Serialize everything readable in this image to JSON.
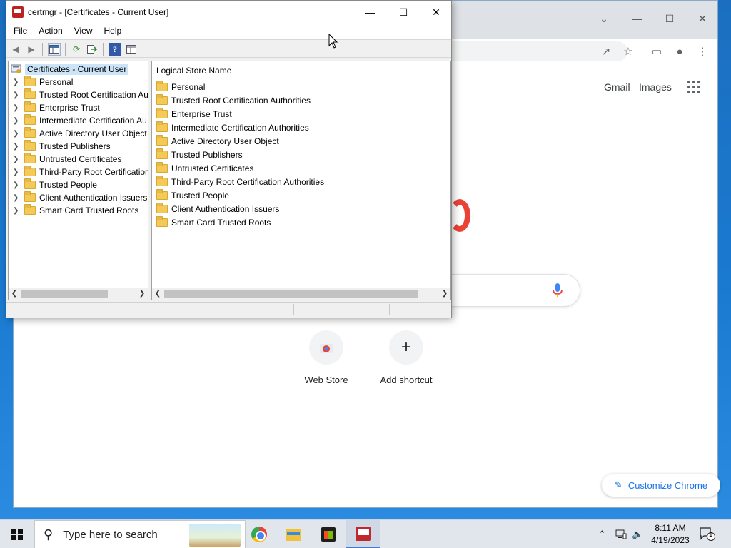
{
  "certmgr": {
    "title": "certmgr - [Certificates - Current User]",
    "menu": [
      "File",
      "Action",
      "View",
      "Help"
    ],
    "tree_root": "Certificates - Current User",
    "tree_items": [
      "Personal",
      "Trusted Root Certification Au",
      "Enterprise Trust",
      "Intermediate Certification Au",
      "Active Directory User Object",
      "Trusted Publishers",
      "Untrusted Certificates",
      "Third-Party Root Certificatior",
      "Trusted People",
      "Client Authentication Issuers",
      "Smart Card Trusted Roots"
    ],
    "list_header": "Logical Store Name",
    "list_items": [
      "Personal",
      "Trusted Root Certification Authorities",
      "Enterprise Trust",
      "Intermediate Certification Authorities",
      "Active Directory User Object",
      "Trusted Publishers",
      "Untrusted Certificates",
      "Third-Party Root Certification Authorities",
      "Trusted People",
      "Client Authentication Issuers",
      "Smart Card Trusted Roots"
    ]
  },
  "chrome": {
    "gmail": "Gmail",
    "images": "Images",
    "shortcuts": [
      {
        "label": "Web Store"
      },
      {
        "label": "Add shortcut",
        "symbol": "+"
      }
    ],
    "customize": "Customize Chrome",
    "accent": "#1a73e8"
  },
  "taskbar": {
    "search_placeholder": "Type here to search",
    "time": "8:11 AM",
    "date": "4/19/2023",
    "notification_count": "1"
  },
  "icons": {
    "back": "back-arrow-icon",
    "forward": "forward-arrow-icon",
    "show_hide_tree": "show-hide-tree-icon",
    "refresh": "refresh-icon",
    "export": "export-list-icon",
    "help": "help-icon",
    "properties": "properties-icon"
  }
}
